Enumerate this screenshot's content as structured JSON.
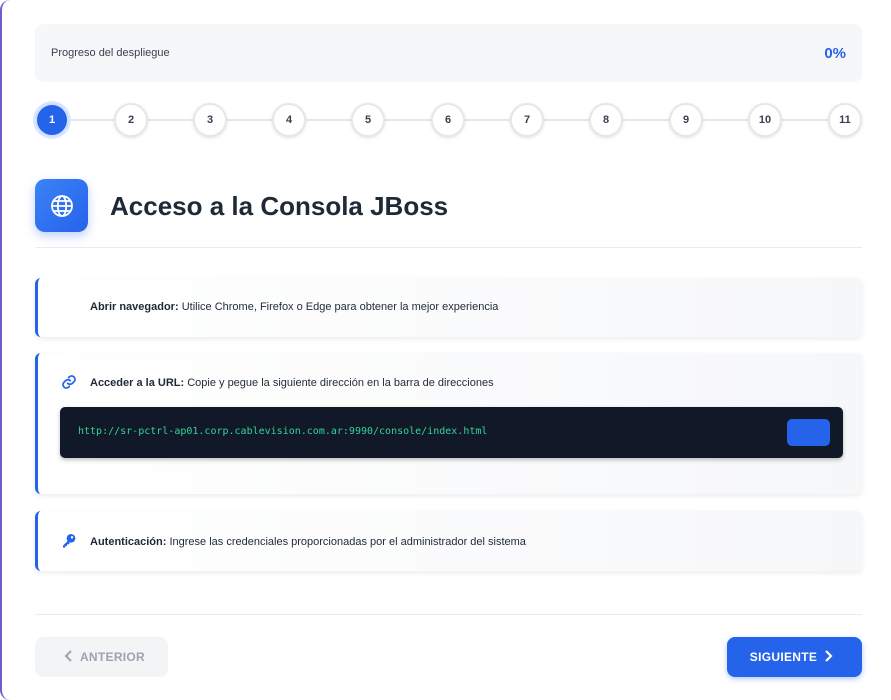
{
  "progress": {
    "label": "Progreso del despliegue",
    "value": "0%"
  },
  "stepper": {
    "active_step": 1,
    "steps": [
      "1",
      "2",
      "3",
      "4",
      "5",
      "6",
      "7",
      "8",
      "9",
      "10",
      "11"
    ]
  },
  "section": {
    "icon": "globe-icon",
    "title": "Acceso a la Consola JBoss"
  },
  "instructions": [
    {
      "icon": "",
      "title": "Abrir navegador:",
      "text": " Utilice Chrome, Firefox o Edge para obtener la mejor experiencia"
    },
    {
      "icon": "link-icon",
      "title": "Acceder a la URL:",
      "text": " Copie y pegue la siguiente dirección en la barra de direcciones",
      "url": "http://sr-pctrl-ap01.corp.cablevision.com.ar:9990/console/index.html"
    },
    {
      "icon": "key-icon",
      "title": "Autenticación:",
      "text": " Ingrese las credenciales proporcionadas por el administrador del sistema"
    }
  ],
  "navigation": {
    "prev_label": "ANTERIOR",
    "next_label": "SIGUIENTE"
  },
  "colors": {
    "accent": "#2563eb",
    "code_bg": "#111827",
    "code_text": "#34d399"
  }
}
